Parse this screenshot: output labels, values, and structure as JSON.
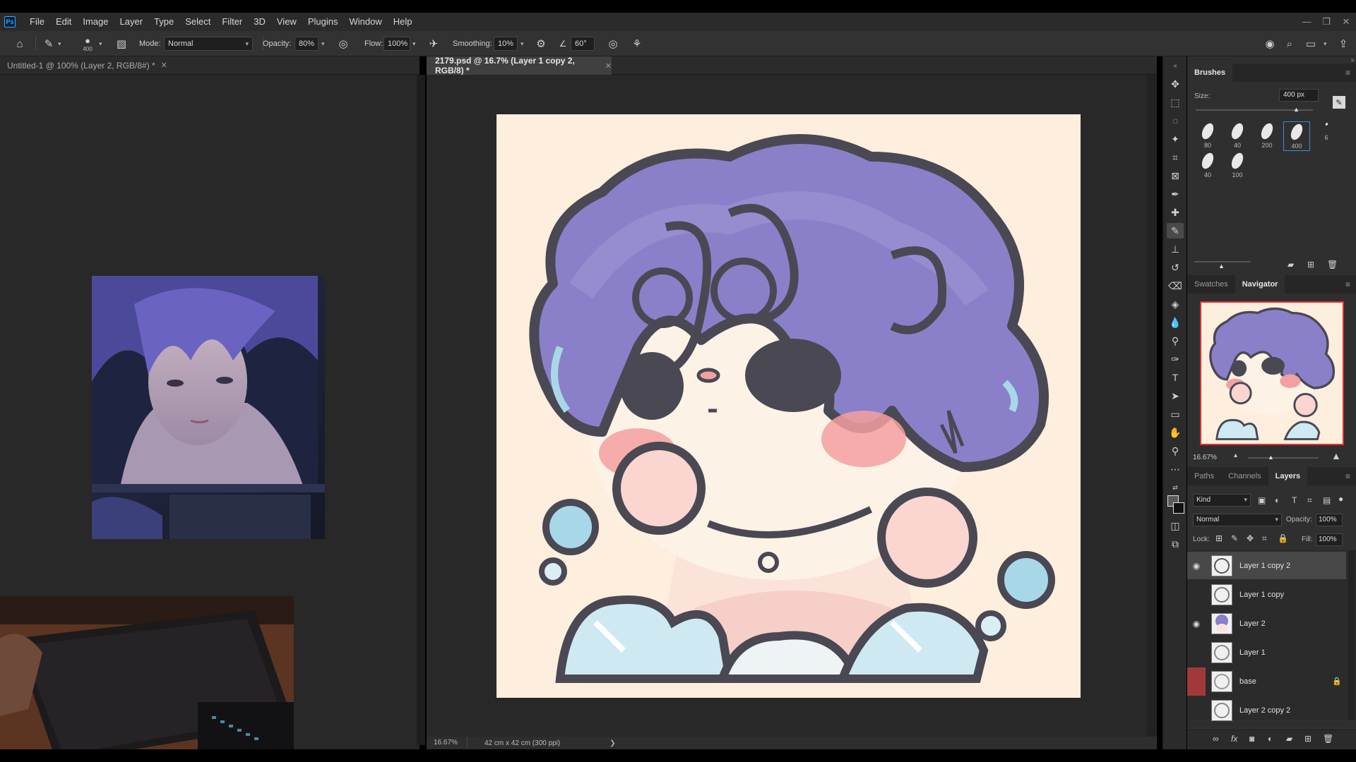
{
  "menu": {
    "items": [
      "File",
      "Edit",
      "Image",
      "Layer",
      "Type",
      "Select",
      "Filter",
      "3D",
      "View",
      "Plugins",
      "Window",
      "Help"
    ],
    "app_logo": "Ps"
  },
  "options": {
    "brush_size": "400",
    "mode_label": "Mode:",
    "mode_value": "Normal",
    "opacity_label": "Opacity:",
    "opacity_value": "80%",
    "flow_label": "Flow:",
    "flow_value": "100%",
    "smoothing_label": "Smoothing:",
    "smoothing_value": "10%",
    "angle_value": "60°"
  },
  "documents": {
    "left_tab": "Untitled-1 @ 100% (Layer 2, RGB/8#) *",
    "main_tab": "2179.psd @ 16.7% (Layer 1 copy 2, RGB/8) *"
  },
  "status": {
    "zoom": "16.67%",
    "doc_size": "42 cm x 42 cm (300 ppi)",
    "arrow": "❯"
  },
  "brushes": {
    "tab": "Brushes",
    "size_label": "Size:",
    "size_value": "400 px",
    "presets": [
      "80",
      "40",
      "200",
      "400",
      "6",
      "40",
      "100"
    ]
  },
  "navigator": {
    "tabs": [
      "Swatches",
      "Navigator"
    ],
    "zoom": "16.67%"
  },
  "layers": {
    "tabs": [
      "Paths",
      "Channels",
      "Layers"
    ],
    "filter": "Kind",
    "blend": "Normal",
    "opacity_label": "Opacity:",
    "opacity_value": "100%",
    "lock_label": "Lock:",
    "fill_label": "Fill:",
    "fill_value": "100%",
    "rows": [
      {
        "name": "Layer 1 copy 2"
      },
      {
        "name": "Layer 1 copy"
      },
      {
        "name": "Layer 2"
      },
      {
        "name": "Layer 1"
      },
      {
        "name": "base"
      },
      {
        "name": "Layer 2 copy 2"
      }
    ]
  },
  "colors": {
    "accent": "#31a8ff",
    "canvas_bg": "#fdeedd",
    "hair": "#8a80c9",
    "outline": "#4a4853",
    "blush": "#f3a0a0",
    "highlight_blue": "#a8d8e8"
  }
}
